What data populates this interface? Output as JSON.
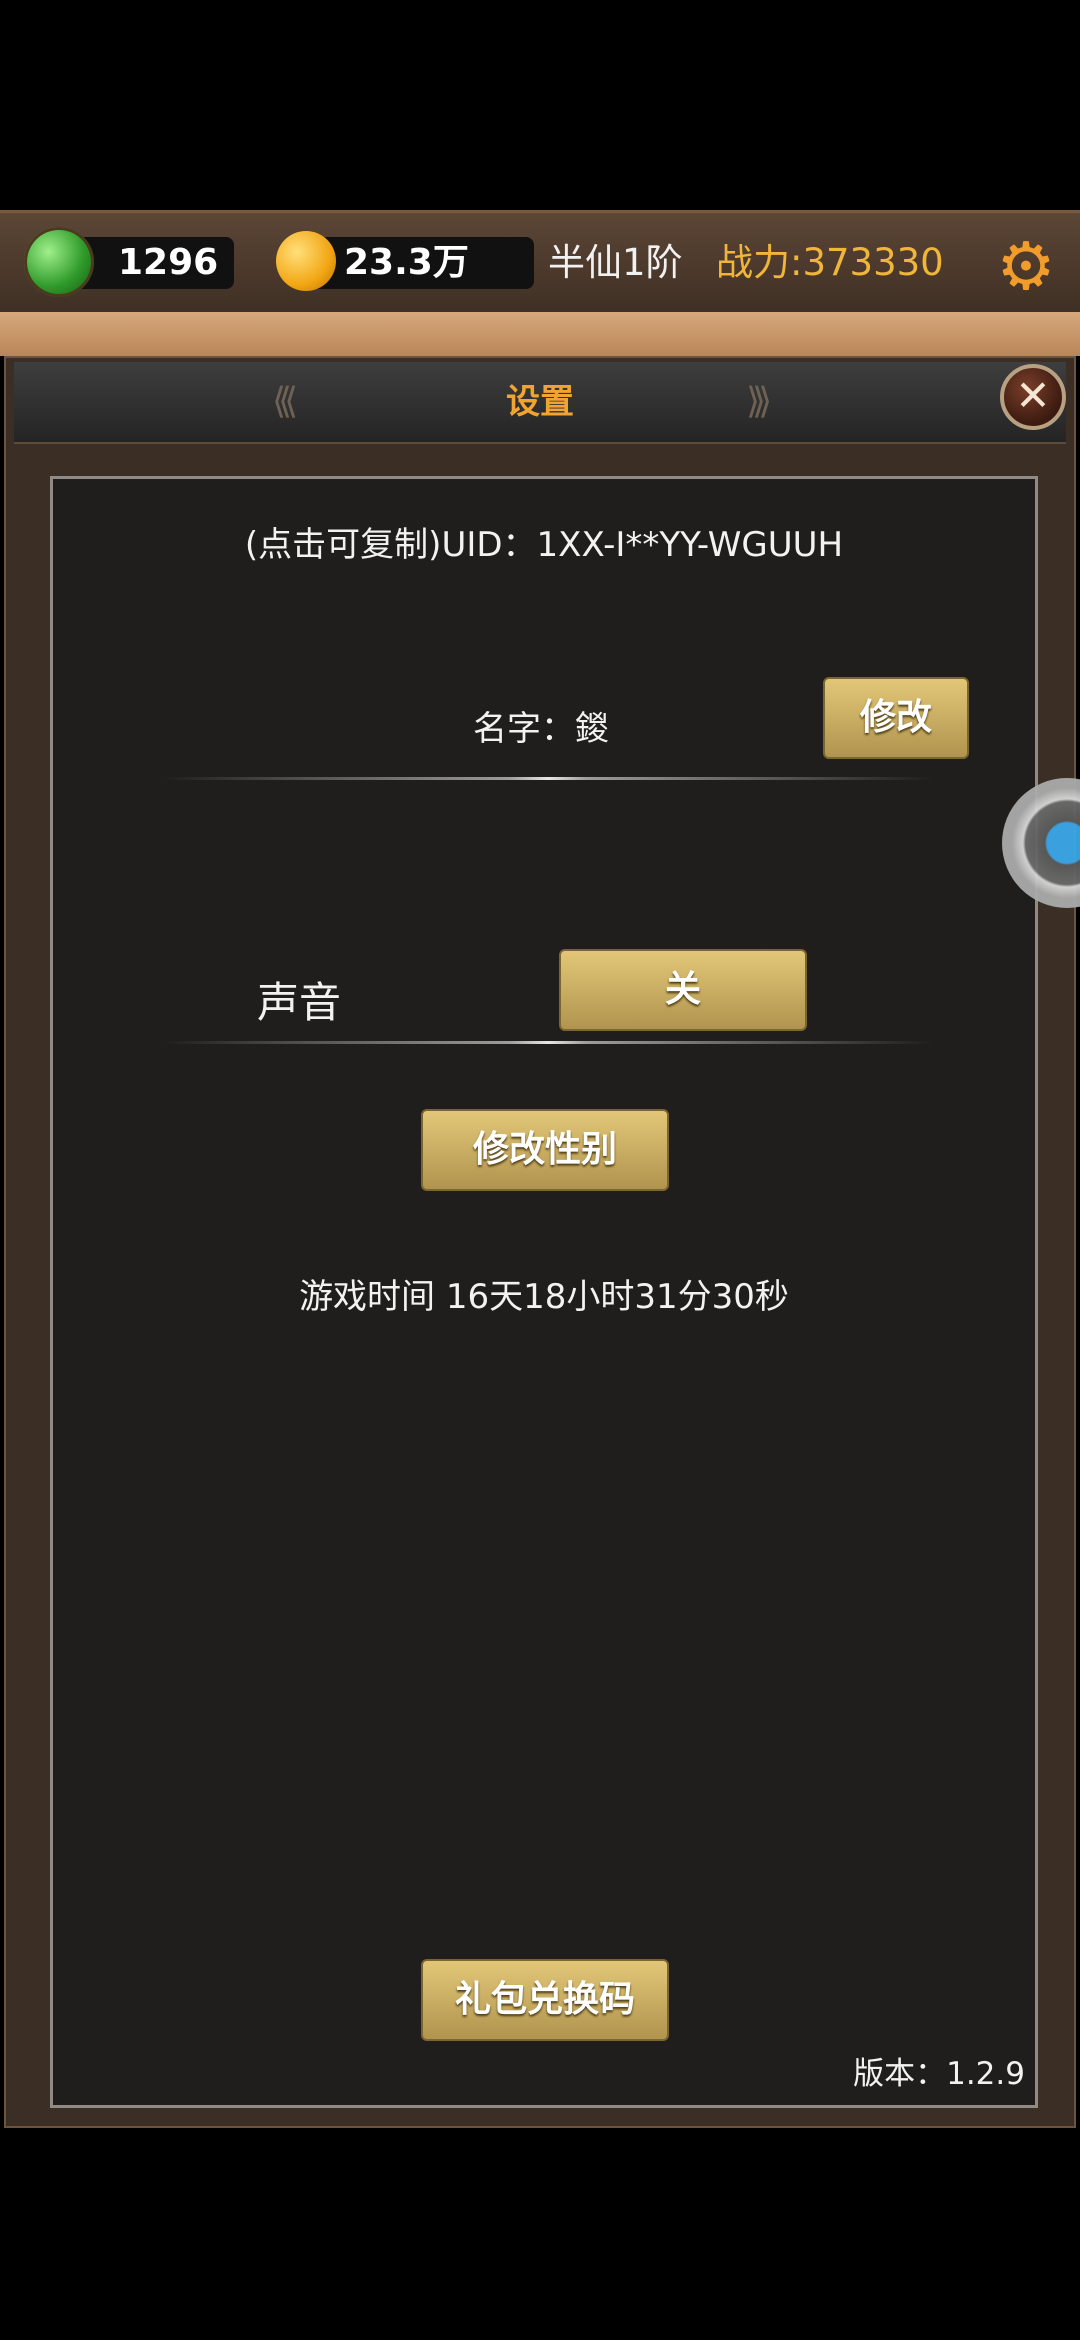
{
  "topbar": {
    "jade_count": "1296",
    "coin_amount": "23.3万",
    "rank": "半仙1阶",
    "power": "战力:373330"
  },
  "panel": {
    "title": "设置",
    "close_glyph": "✕",
    "uid_text": "(点击可复制)UID：1XX-I**YY-WGUUH",
    "name_text": "名字：鍐",
    "rename_button": "修改",
    "sound_label": "声音",
    "sound_toggle": "关",
    "change_gender_button": "修改性别",
    "play_time": "游戏时间 16天18小时31分30秒",
    "gift_code_button": "礼包兑换码",
    "version": "版本：1.2.9"
  },
  "colors": {
    "accent_gold": "#f0a431",
    "power_color": "#f0b63a",
    "button_gold": "#e2c778"
  },
  "icons": {
    "jade": "jade-currency-icon",
    "coin": "gold-coin-icon",
    "settings": "gear-icon",
    "close": "close-icon",
    "float": "floating-assistant-icon"
  }
}
